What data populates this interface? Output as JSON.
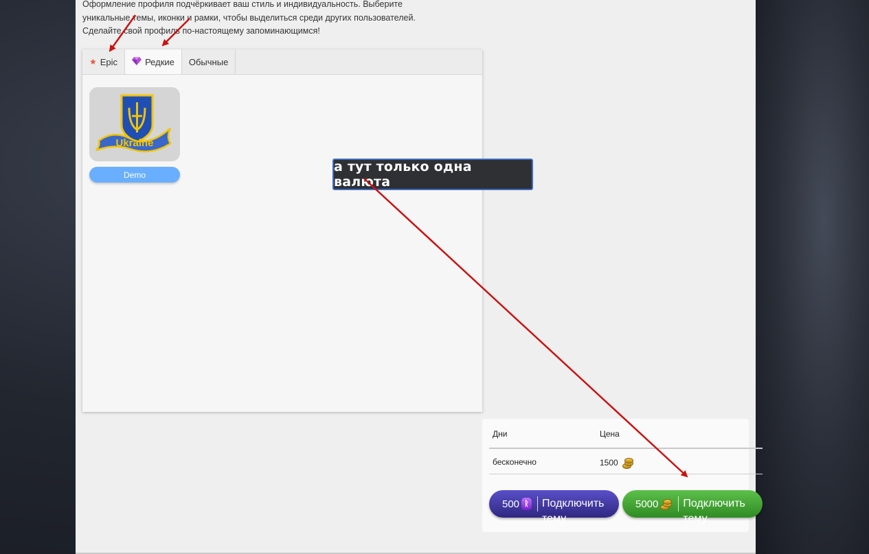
{
  "intro": {
    "line1": "Оформление профиля подчёркивает ваш стиль и индивидуальность. Выберите",
    "line2": "уникальные темы, иконки и рамки, чтобы выделиться среди других пользователей.",
    "line3": "Сделайте свой профиль по-настоящему запоминающимся!"
  },
  "tabs": [
    {
      "label": "Epic",
      "icon": "star-icon"
    },
    {
      "label": "Редкие",
      "icon": "gem-icon",
      "active": true
    },
    {
      "label": "Обычные"
    }
  ],
  "card": {
    "image_text": "Ukraine",
    "button_label": "Demo"
  },
  "annotation": {
    "text": "а тут только одна валюта"
  },
  "pricing": {
    "head_days": "Дни",
    "head_price": "Цена",
    "row_days": "бесконечно",
    "row_price": "1500"
  },
  "buttons": [
    {
      "price": "500",
      "currency_icon": "rune-icon",
      "label": "Подключить тему",
      "color": "#3a32a0"
    },
    {
      "price": "5000",
      "currency_icon": "coin-icon",
      "label": "Подключить тему",
      "color": "#3f9e30"
    }
  ],
  "colors": {
    "annotation_arrow": "#cc1111",
    "demo_button": "#6aafff"
  }
}
